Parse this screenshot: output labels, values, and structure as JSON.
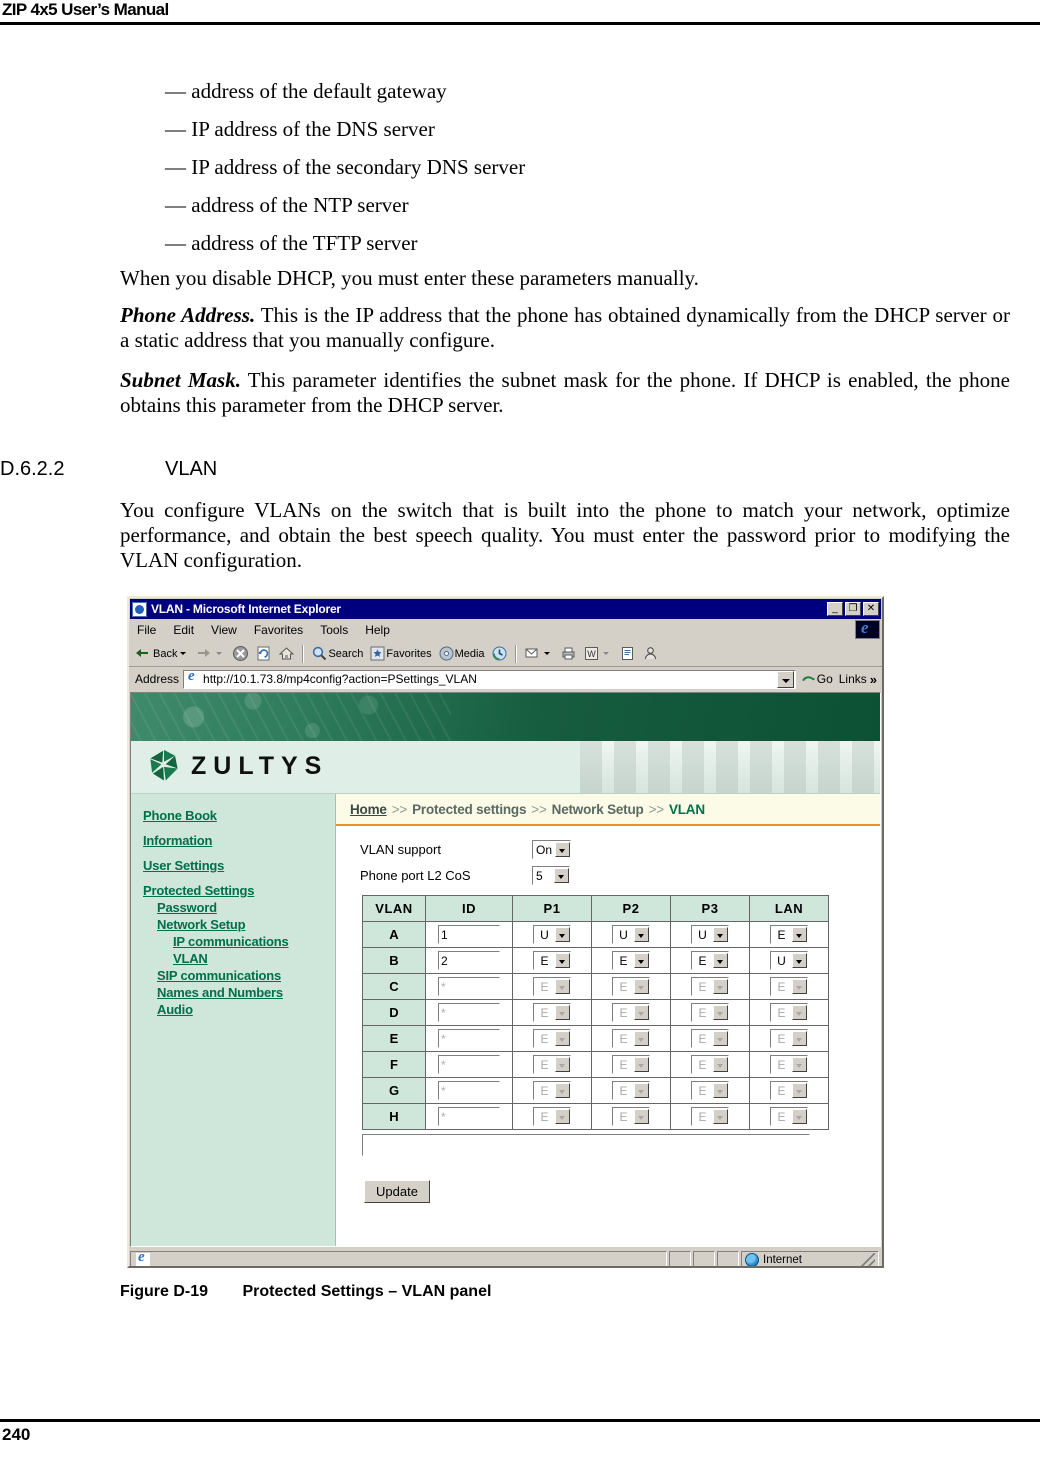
{
  "page": {
    "running_head": "ZIP 4x5 User’s Manual",
    "page_number": "240"
  },
  "body": {
    "dash_items": [
      "— address of the default gateway",
      "— IP address of the DNS server",
      "— IP address of the secondary DNS server",
      "— address of the NTP server",
      "— address of the TFTP server"
    ],
    "para_dhcp": "When you disable DHCP, you must enter these parameters manually.",
    "phone_address_lead": "Phone Address.",
    "phone_address_text": " This is the IP address that the phone has obtained dynamically from the DHCP server or a static address that you manually configure.",
    "subnet_mask_lead": "Subnet Mask.",
    "subnet_mask_text": " This parameter identifies the subnet mask for the phone. If DHCP is enabled, the phone obtains this parameter from the DHCP server.",
    "section_number": "D.6.2.2",
    "section_title": "VLAN",
    "vlan_intro": "You configure VLANs on the switch that is built into the phone to match your network, optimize performance, and obtain the best speech quality. You must enter the password prior to modifying the VLAN configuration."
  },
  "figure": {
    "caption_number": "Figure D-19",
    "caption_text": "Protected Settings – VLAN panel"
  },
  "browser": {
    "title": "VLAN - Microsoft Internet Explorer",
    "window_buttons": {
      "minimize": "_",
      "restore": "❐",
      "close": "✕"
    },
    "menu": [
      "File",
      "Edit",
      "View",
      "Favorites",
      "Tools",
      "Help"
    ],
    "toolbar": {
      "back": "Back",
      "forward": "",
      "stop": "",
      "refresh": "",
      "home": "",
      "search": "Search",
      "favorites": "Favorites",
      "media": "Media",
      "history": "",
      "mail": "",
      "print": "",
      "edit": "",
      "discuss": "",
      "messenger": ""
    },
    "address": {
      "label": "Address",
      "url": "http://10.1.73.8/mp4config?action=PSettings_VLAN",
      "go_label": "Go",
      "links_label": "Links",
      "links_chevron": "»"
    },
    "status": {
      "message": "",
      "zone": "Internet"
    }
  },
  "site": {
    "logo_word": "ZULTYS",
    "breadcrumb": {
      "home": "Home",
      "separator": ">>",
      "level2": "Protected settings",
      "level3": "Network Setup",
      "current": "VLAN"
    },
    "nav": [
      {
        "label": "Phone Book",
        "level": 1
      },
      {
        "label": "Information",
        "level": 1
      },
      {
        "label": "User Settings",
        "level": 1
      },
      {
        "label": "Protected Settings",
        "level": 1
      },
      {
        "label": "Password",
        "level": 2
      },
      {
        "label": "Network Setup",
        "level": 2
      },
      {
        "label": "IP communications",
        "level": 3
      },
      {
        "label": "VLAN",
        "level": 3
      },
      {
        "label": "SIP communications",
        "level": 2
      },
      {
        "label": "Names and Numbers",
        "level": 2
      },
      {
        "label": "Audio",
        "level": 2
      }
    ],
    "form": {
      "vlan_support_label": "VLAN support",
      "vlan_support_value": "On",
      "l2cos_label": "Phone port L2 CoS",
      "l2cos_value": "5",
      "wide_input_value": "",
      "update_label": "Update"
    },
    "table": {
      "headers": [
        "VLAN",
        "ID",
        "P1",
        "P2",
        "P3",
        "LAN"
      ],
      "rows": [
        {
          "vlan": "A",
          "id": "1",
          "p1": "U",
          "p2": "U",
          "p3": "U",
          "lan": "E",
          "disabled": false
        },
        {
          "vlan": "B",
          "id": "2",
          "p1": "E",
          "p2": "E",
          "p3": "E",
          "lan": "U",
          "disabled": false
        },
        {
          "vlan": "C",
          "id": "*",
          "p1": "E",
          "p2": "E",
          "p3": "E",
          "lan": "E",
          "disabled": true
        },
        {
          "vlan": "D",
          "id": "*",
          "p1": "E",
          "p2": "E",
          "p3": "E",
          "lan": "E",
          "disabled": true
        },
        {
          "vlan": "E",
          "id": "*",
          "p1": "E",
          "p2": "E",
          "p3": "E",
          "lan": "E",
          "disabled": true
        },
        {
          "vlan": "F",
          "id": "*",
          "p1": "E",
          "p2": "E",
          "p3": "E",
          "lan": "E",
          "disabled": true
        },
        {
          "vlan": "G",
          "id": "*",
          "p1": "E",
          "p2": "E",
          "p3": "E",
          "lan": "E",
          "disabled": true
        },
        {
          "vlan": "H",
          "id": "*",
          "p1": "E",
          "p2": "E",
          "p3": "E",
          "lan": "E",
          "disabled": true
        }
      ]
    }
  },
  "colors": {
    "titlebar": "#00007e",
    "brand_green": "#00704a",
    "banner_green": "#16603f",
    "sidebar_mint": "#cfe6da",
    "crumb_bg": "#fbfbe8",
    "crumb_rule": "#e8912a",
    "chrome_grey": "#d4d0c8"
  }
}
